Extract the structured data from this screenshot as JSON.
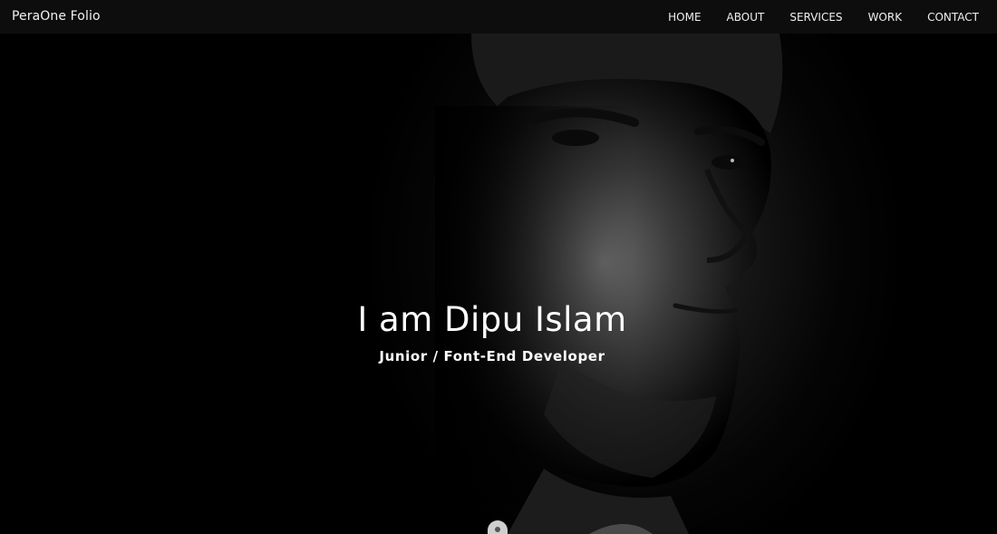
{
  "navbar": {
    "brand": "PeraOne Folio",
    "links": [
      {
        "label": "HOME"
      },
      {
        "label": "ABOUT"
      },
      {
        "label": "SERVICES"
      },
      {
        "label": "WORK"
      },
      {
        "label": "CONTACT"
      }
    ]
  },
  "hero": {
    "title": "I am Dipu Islam",
    "subtitle": "Junior / Font-End Developer",
    "scroll_icon": "mouse-scroll-icon"
  },
  "colors": {
    "navbar_bg": "#0d0d0d",
    "hero_bg": "#000000",
    "text": "#ffffff"
  }
}
